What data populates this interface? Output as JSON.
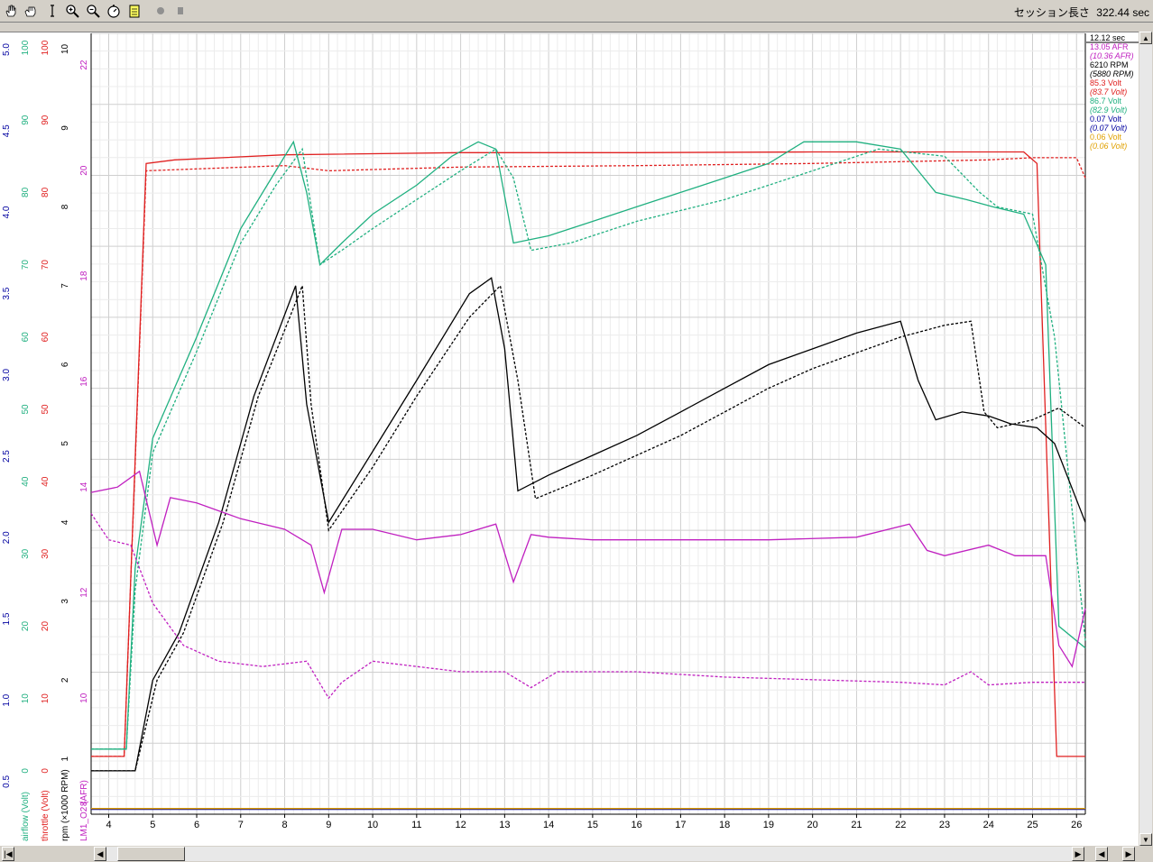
{
  "toolbar": {
    "icons": [
      "hand-icon",
      "grab-hand-icon",
      "text-cursor-icon",
      "zoom-in-icon",
      "zoom-out-icon",
      "stopwatch-icon",
      "notepad-icon",
      "record-icon",
      "stop-icon"
    ],
    "session_label": "セッション長さ",
    "session_value": "322.44 sec"
  },
  "legend": {
    "time": "12.12 sec",
    "entries": [
      {
        "text": "13.05 AFR",
        "color": "#c020c0",
        "italic": false
      },
      {
        "text": "(10.36 AFR)",
        "color": "#c020c0",
        "italic": true
      },
      {
        "text": "6210 RPM",
        "color": "#000000",
        "italic": false
      },
      {
        "text": "(5880 RPM)",
        "color": "#000000",
        "italic": true
      },
      {
        "text": "85.3 Volt",
        "color": "#e02020",
        "italic": false
      },
      {
        "text": "(83.7 Volt)",
        "color": "#e02020",
        "italic": true
      },
      {
        "text": "86.7 Volt",
        "color": "#20b080",
        "italic": false
      },
      {
        "text": "(82.9 Volt)",
        "color": "#20b080",
        "italic": true
      },
      {
        "text": "0.07 Volt",
        "color": "#0000a0",
        "italic": false
      },
      {
        "text": "(0.07 Volt)",
        "color": "#0000a0",
        "italic": true
      },
      {
        "text": "0.06 Volt",
        "color": "#e0a000",
        "italic": false
      },
      {
        "text": "(0.06 Volt)",
        "color": "#e0a000",
        "italic": true
      }
    ]
  },
  "chart_data": {
    "type": "line",
    "xlim": [
      3.6,
      26.2
    ],
    "x_ticks": [
      "4",
      "5",
      "6",
      "7",
      "8",
      "9",
      "10",
      "11",
      "12",
      "13",
      "14",
      "15",
      "16",
      "17",
      "18",
      "19",
      "20",
      "21",
      "22",
      "23",
      "24",
      "25",
      "26"
    ],
    "axes": [
      {
        "label": "",
        "color": "#0000a0",
        "min": 0.3,
        "max": 5.1,
        "ticks": [
          "0.5",
          "1.0",
          "1.5",
          "2.0",
          "2.5",
          "3.0",
          "3.5",
          "4.0",
          "4.5",
          "5.0"
        ]
      },
      {
        "label": "airflow (Volt)",
        "color": "#20b080",
        "min": -6,
        "max": 102,
        "ticks": [
          "0",
          "10",
          "20",
          "30",
          "40",
          "50",
          "60",
          "70",
          "80",
          "90",
          "100"
        ]
      },
      {
        "label": "throttle (Volt)",
        "color": "#e02020",
        "min": -6,
        "max": 102,
        "ticks": [
          "0",
          "10",
          "20",
          "30",
          "40",
          "50",
          "60",
          "70",
          "80",
          "90",
          "100"
        ]
      },
      {
        "label": "rpm (×1000 RPM)",
        "color": "#000000",
        "min": 0.3,
        "max": 10.2,
        "ticks": [
          "1",
          "2",
          "3",
          "4",
          "5",
          "6",
          "7",
          "8",
          "9",
          "10"
        ]
      },
      {
        "label": "LM1_O2 (AFR)",
        "color": "#c020c0",
        "min": 7.8,
        "max": 22.6,
        "ticks": [
          "8",
          "10",
          "12",
          "14",
          "16",
          "18",
          "20",
          "22"
        ]
      }
    ],
    "series": [
      {
        "axis": 2,
        "color": "#e02020",
        "dash": false,
        "points": [
          [
            3.6,
            2
          ],
          [
            4.35,
            2
          ],
          [
            4.85,
            84
          ],
          [
            5.5,
            84.5
          ],
          [
            8,
            85.2
          ],
          [
            12,
            85.5
          ],
          [
            16,
            85.5
          ],
          [
            20,
            85.6
          ],
          [
            24.8,
            85.6
          ],
          [
            25.1,
            84
          ],
          [
            25.55,
            2
          ],
          [
            26.2,
            2
          ]
        ]
      },
      {
        "axis": 2,
        "color": "#e02020",
        "dash": true,
        "points": [
          [
            3.6,
            2
          ],
          [
            4.35,
            2
          ],
          [
            4.85,
            83
          ],
          [
            8,
            83.7
          ],
          [
            9,
            83
          ],
          [
            12,
            83.5
          ],
          [
            16,
            83.7
          ],
          [
            20,
            84
          ],
          [
            24,
            84.5
          ],
          [
            25,
            84.8
          ],
          [
            26,
            84.8
          ],
          [
            26.2,
            82
          ]
        ]
      },
      {
        "axis": 1,
        "color": "#20b080",
        "dash": false,
        "points": [
          [
            3.6,
            3
          ],
          [
            4.4,
            3
          ],
          [
            4.6,
            28
          ],
          [
            5,
            46
          ],
          [
            6,
            60
          ],
          [
            7,
            75
          ],
          [
            7.8,
            83
          ],
          [
            8.2,
            87
          ],
          [
            8.5,
            80
          ],
          [
            8.8,
            70
          ],
          [
            9.3,
            73
          ],
          [
            10,
            77
          ],
          [
            11,
            81
          ],
          [
            11.8,
            85
          ],
          [
            12.4,
            87
          ],
          [
            12.8,
            86
          ],
          [
            13.2,
            73
          ],
          [
            14,
            74
          ],
          [
            15,
            76
          ],
          [
            16,
            78
          ],
          [
            17,
            80
          ],
          [
            18,
            82
          ],
          [
            19,
            84
          ],
          [
            19.8,
            87
          ],
          [
            21,
            87
          ],
          [
            22,
            86
          ],
          [
            22.8,
            80
          ],
          [
            23.5,
            79
          ],
          [
            24.1,
            78
          ],
          [
            24.8,
            77
          ],
          [
            25.3,
            70
          ],
          [
            25.6,
            20
          ],
          [
            26.2,
            17
          ]
        ]
      },
      {
        "axis": 1,
        "color": "#20b080",
        "dash": true,
        "points": [
          [
            3.6,
            3
          ],
          [
            4.4,
            3
          ],
          [
            4.6,
            25
          ],
          [
            5,
            44
          ],
          [
            6,
            58
          ],
          [
            7,
            73
          ],
          [
            7.8,
            81
          ],
          [
            8.4,
            86
          ],
          [
            8.8,
            70
          ],
          [
            9.3,
            72
          ],
          [
            10,
            75
          ],
          [
            11,
            79
          ],
          [
            12,
            83
          ],
          [
            12.8,
            86
          ],
          [
            13.2,
            82
          ],
          [
            13.6,
            72
          ],
          [
            14.5,
            73
          ],
          [
            16,
            76
          ],
          [
            18,
            79
          ],
          [
            20,
            83
          ],
          [
            21.5,
            86
          ],
          [
            23,
            85
          ],
          [
            23.8,
            80
          ],
          [
            24.2,
            78
          ],
          [
            25,
            77
          ],
          [
            25.5,
            60
          ],
          [
            26.2,
            18
          ]
        ]
      },
      {
        "axis": 3,
        "color": "#000000",
        "dash": false,
        "points": [
          [
            3.6,
            0.85
          ],
          [
            4.6,
            0.85
          ],
          [
            5,
            2.0
          ],
          [
            5.6,
            2.6
          ],
          [
            6.5,
            4.0
          ],
          [
            7.3,
            5.6
          ],
          [
            8.25,
            7.0
          ],
          [
            8.5,
            5.5
          ],
          [
            9,
            4.0
          ],
          [
            10,
            4.9
          ],
          [
            11,
            5.8
          ],
          [
            12.2,
            6.9
          ],
          [
            12.7,
            7.1
          ],
          [
            13,
            6.2
          ],
          [
            13.3,
            4.4
          ],
          [
            14,
            4.6
          ],
          [
            15,
            4.85
          ],
          [
            16,
            5.1
          ],
          [
            17,
            5.4
          ],
          [
            18,
            5.7
          ],
          [
            19,
            6.0
          ],
          [
            20,
            6.2
          ],
          [
            21,
            6.4
          ],
          [
            22,
            6.55
          ],
          [
            22.4,
            5.8
          ],
          [
            22.8,
            5.3
          ],
          [
            23.4,
            5.4
          ],
          [
            24,
            5.35
          ],
          [
            24.5,
            5.25
          ],
          [
            25.1,
            5.2
          ],
          [
            25.5,
            5.0
          ],
          [
            26.2,
            4.0
          ]
        ]
      },
      {
        "axis": 3,
        "color": "#000000",
        "dash": true,
        "points": [
          [
            3.6,
            0.85
          ],
          [
            4.6,
            0.85
          ],
          [
            5.1,
            2.0
          ],
          [
            5.7,
            2.6
          ],
          [
            6.6,
            4.0
          ],
          [
            7.4,
            5.6
          ],
          [
            8.4,
            7.0
          ],
          [
            8.6,
            5.5
          ],
          [
            9,
            3.9
          ],
          [
            10,
            4.7
          ],
          [
            11,
            5.6
          ],
          [
            12.2,
            6.6
          ],
          [
            12.9,
            7.0
          ],
          [
            13.3,
            5.8
          ],
          [
            13.7,
            4.3
          ],
          [
            15,
            4.6
          ],
          [
            16,
            4.85
          ],
          [
            17,
            5.1
          ],
          [
            18,
            5.4
          ],
          [
            19,
            5.7
          ],
          [
            20,
            5.95
          ],
          [
            21,
            6.15
          ],
          [
            22,
            6.35
          ],
          [
            23,
            6.5
          ],
          [
            23.6,
            6.55
          ],
          [
            23.9,
            5.4
          ],
          [
            24.2,
            5.2
          ],
          [
            25,
            5.3
          ],
          [
            25.6,
            5.45
          ],
          [
            26.2,
            5.2
          ]
        ]
      },
      {
        "axis": 4,
        "color": "#c020c0",
        "dash": false,
        "points": [
          [
            3.6,
            13.9
          ],
          [
            4.2,
            14.0
          ],
          [
            4.7,
            14.3
          ],
          [
            5.1,
            12.9
          ],
          [
            5.4,
            13.8
          ],
          [
            6,
            13.7
          ],
          [
            7,
            13.4
          ],
          [
            8,
            13.2
          ],
          [
            8.6,
            12.9
          ],
          [
            8.9,
            12.0
          ],
          [
            9.3,
            13.2
          ],
          [
            10,
            13.2
          ],
          [
            11,
            13.0
          ],
          [
            12,
            13.1
          ],
          [
            12.8,
            13.3
          ],
          [
            13.2,
            12.2
          ],
          [
            13.6,
            13.1
          ],
          [
            14,
            13.05
          ],
          [
            15,
            13.0
          ],
          [
            17,
            13.0
          ],
          [
            19,
            13.0
          ],
          [
            21,
            13.05
          ],
          [
            22.2,
            13.3
          ],
          [
            22.6,
            12.8
          ],
          [
            23,
            12.7
          ],
          [
            24,
            12.9
          ],
          [
            24.6,
            12.7
          ],
          [
            25.3,
            12.7
          ],
          [
            25.6,
            11.0
          ],
          [
            25.9,
            10.6
          ],
          [
            26.2,
            11.7
          ]
        ]
      },
      {
        "axis": 4,
        "color": "#c020c0",
        "dash": true,
        "points": [
          [
            3.6,
            13.5
          ],
          [
            4,
            13.0
          ],
          [
            4.5,
            12.9
          ],
          [
            5,
            11.8
          ],
          [
            5.7,
            11.0
          ],
          [
            6.5,
            10.7
          ],
          [
            7.5,
            10.6
          ],
          [
            8.5,
            10.7
          ],
          [
            9,
            10.0
          ],
          [
            9.3,
            10.3
          ],
          [
            10,
            10.7
          ],
          [
            11,
            10.6
          ],
          [
            12,
            10.5
          ],
          [
            13,
            10.5
          ],
          [
            13.6,
            10.2
          ],
          [
            14.2,
            10.5
          ],
          [
            16,
            10.5
          ],
          [
            18,
            10.4
          ],
          [
            20,
            10.35
          ],
          [
            22,
            10.3
          ],
          [
            23,
            10.25
          ],
          [
            23.6,
            10.5
          ],
          [
            24,
            10.25
          ],
          [
            25,
            10.3
          ],
          [
            26.2,
            10.3
          ]
        ]
      },
      {
        "axis": 0,
        "color": "#0000a0",
        "dash": false,
        "points": [
          [
            3.6,
            0.33
          ],
          [
            26.2,
            0.33
          ]
        ]
      },
      {
        "axis": 0,
        "color": "#e0a000",
        "dash": false,
        "points": [
          [
            3.6,
            0.335
          ],
          [
            26.2,
            0.335
          ]
        ]
      }
    ]
  }
}
